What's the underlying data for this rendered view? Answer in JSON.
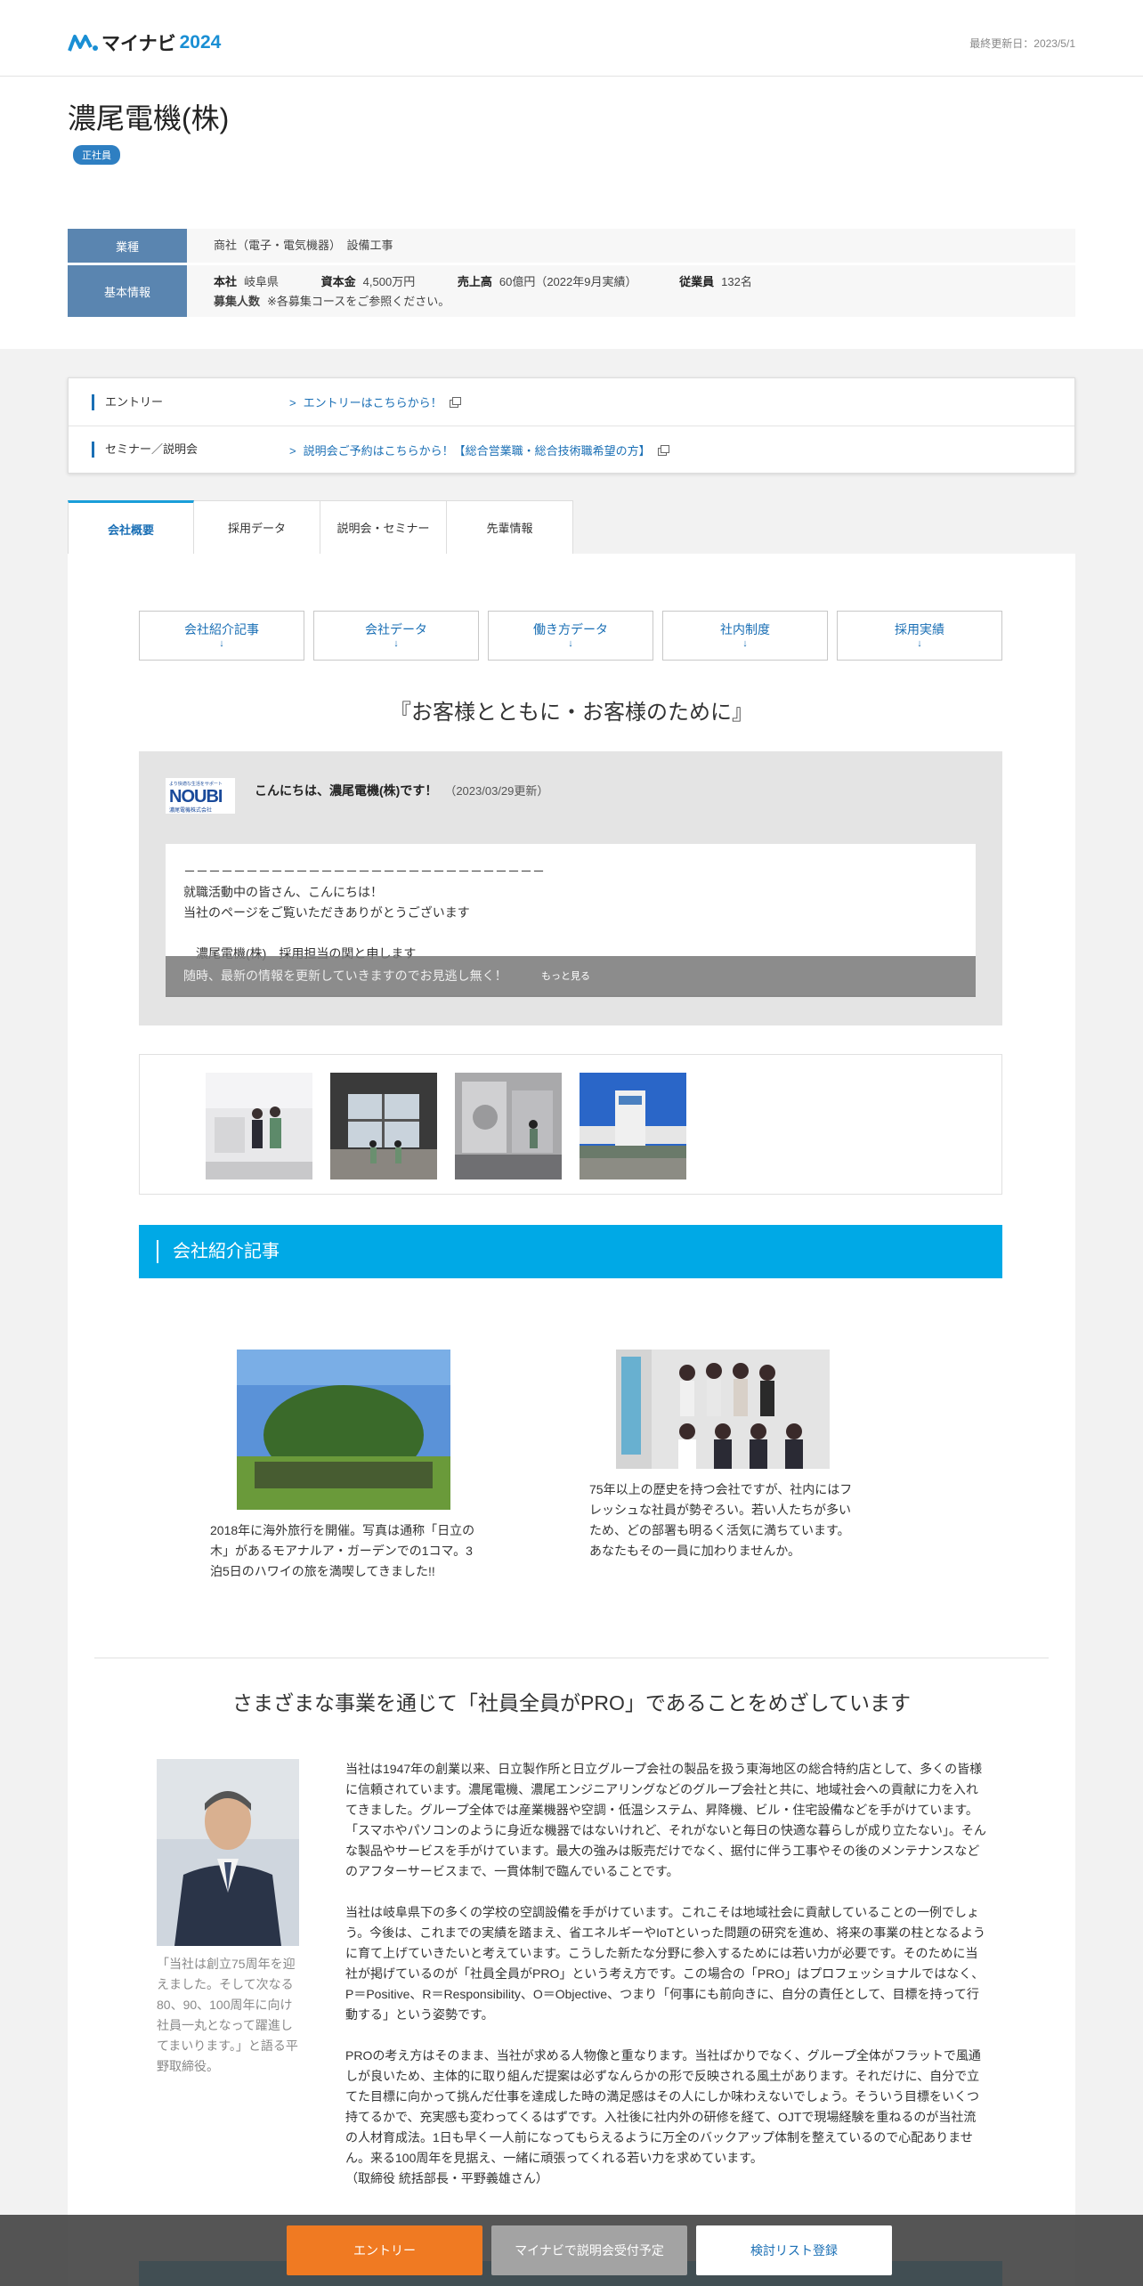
{
  "header": {
    "logo_text": "マイナビ",
    "logo_year": "2024",
    "last_updated": "最終更新日：2023/5/1"
  },
  "company": {
    "name": "濃尾電機(株)",
    "badge": "正社員"
  },
  "info": {
    "industry_label": "業種",
    "industry_value": "商社（電子・電気機器）　設備工事",
    "basic_label": "基本情報",
    "hq_key": "本社",
    "hq_value": "岐阜県",
    "capital_key": "資本金",
    "capital_value": "4,500万円",
    "sales_key": "売上高",
    "sales_value": "60億円（2022年9月実績）",
    "employees_key": "従業員",
    "employees_value": "132名",
    "recruit_key": "募集人数",
    "recruit_value": "※各募集コースをご参照ください。"
  },
  "entry": {
    "entry_label": "エントリー",
    "entry_link": "エントリーはこちらから！",
    "seminar_label": "セミナー／説明会",
    "seminar_link": "説明会ご予約はこちらから！【総合営業職・総合技術職希望の方】",
    "chevron": ">"
  },
  "tabs": [
    "会社概要",
    "採用データ",
    "説明会・セミナー",
    "先輩情報"
  ],
  "anchors": [
    {
      "label": "会社紹介記事",
      "arrow": "↓"
    },
    {
      "label": "会社データ",
      "arrow": "↓"
    },
    {
      "label": "働き方データ",
      "arrow": "↓"
    },
    {
      "label": "社内制度",
      "arrow": "↓"
    },
    {
      "label": "採用実績",
      "arrow": "↓"
    }
  ],
  "catchphrase": "『お客様とともに・お客様のために』",
  "greeting": {
    "logo_small": "より快適な生活をサポート",
    "logo_big": "NOUBI",
    "logo_sub": "濃尾電機株式会社",
    "title": "こんにちは、濃尾電機(株)です！",
    "updated": "（2023/03/29更新）",
    "lines": [
      "－－－－－－－－－－－－－－－－－－－－－－－－－－－－－",
      "就職活動中の皆さん、こんにちは！",
      "当社のページをご覧いただきありがとうございます",
      "",
      "　濃尾電機(株)　採用担当の関と申します"
    ],
    "more_text": "随時、最新の情報を更新していきますのでお見逃し無く！",
    "more_label": "もっと見る"
  },
  "section1_title": "会社紹介記事",
  "articles": [
    {
      "caption": "2018年に海外旅行を開催。写真は通称「日立の木」があるモアナルア・ガーデンでの1コマ。3泊5日のハワイの旅を満喫してきました!!"
    },
    {
      "caption": "75年以上の歴史を持つ会社ですが、社内にはフレッシュな社員が勢ぞろい。若い人たちが多いため、どの部署も明るく活気に満ちています。あなたもその一員に加わりませんか。"
    }
  ],
  "section2": {
    "title": "さまざまな事業を通じて「社員全員がPRO」であることをめざしています",
    "portrait_caption": "「当社は創立75周年を迎えました。そして次なる80、90、100周年に向け社員一丸となって躍進してまいります。」と語る平野取締役。",
    "paragraphs": [
      "当社は1947年の創業以来、日立製作所と日立グループ会社の製品を扱う東海地区の総合特約店として、多くの皆様に信頼されています。濃尾電機、濃尾エンジニアリングなどのグループ会社と共に、地域社会への貢献に力を入れてきました。グループ全体では産業機器や空調・低温システム、昇降機、ビル・住宅設備などを手がけています。「スマホやパソコンのように身近な機器ではないけれど、それがないと毎日の快適な暮らしが成り立たない」。そんな製品やサービスを手がけています。最大の強みは販売だけでなく、据付に伴う工事やその後のメンテナンスなどのアフターサービスまで、一貫体制で臨んでいることです。",
      "当社は岐阜県下の多くの学校の空調設備を手がけています。これこそは地域社会に貢献していることの一例でしょう。今後は、これまでの実績を踏まえ、省エネルギーやIoTといった問題の研究を進め、将来の事業の柱となるように育て上げていきたいと考えています。こうした新たな分野に参入するためには若い力が必要です。そのために当社が掲げているのが「社員全員がPRO」という考え方です。この場合の「PRO」はプロフェッショナルではなく、P＝Positive、R＝Responsibility、O＝Objective、つまり「何事にも前向きに、自分の責任として、目標を持って行動する」という姿勢です。",
      "PROの考え方はそのまま、当社が求める人物像と重なります。当社ばかりでなく、グループ全体がフラットで風通しが良いため、主体的に取り組んだ提案は必ずなんらかの形で反映される風土があります。それだけに、自分で立てた目標に向かって挑んだ仕事を達成した時の満足感はその人にしか味わえないでしょう。そういう目標をいくつ持てるかで、充実感も変わってくるはずです。入社後に社内外の研修を経て、OJTで現場経験を重ねるのが当社流の人材育成法。1日も早く一人前になってもらえるように万全のバックアップ体制を整えているので心配ありません。来る100周年を見据え、一緒に頑張ってくれる若い力を求めています。",
      "（取締役 統括部長・平野義雄さん）"
    ]
  },
  "bottom_bar": {
    "entry": "エントリー",
    "seminar": "マイナビで説明会受付予定",
    "list": "検討リスト登録"
  },
  "colors": {
    "accent": "#00a9e6",
    "link": "#1a6fb5",
    "entry_orange": "#f07a22",
    "info_head": "#5a85b0"
  }
}
